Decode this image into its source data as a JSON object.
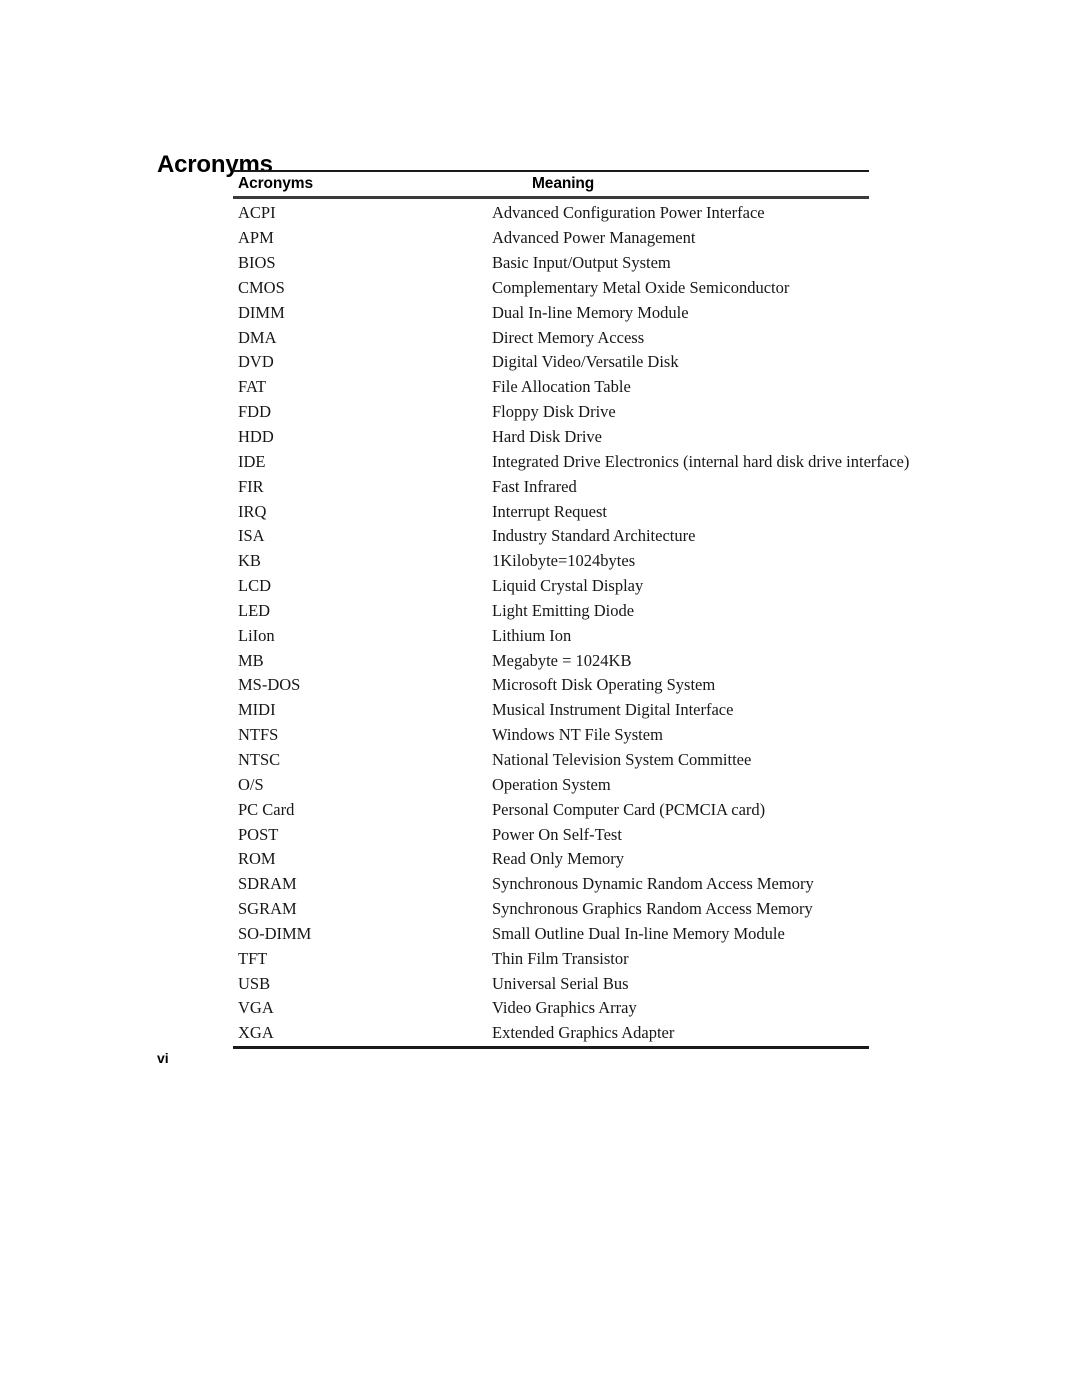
{
  "document": {
    "title": "Acronyms",
    "page_number": "vi"
  },
  "table": {
    "headers": {
      "acronym": "Acronyms",
      "meaning": "Meaning"
    },
    "rows": [
      {
        "acronym": "ACPI",
        "meaning": "Advanced Configuration Power Interface"
      },
      {
        "acronym": "APM",
        "meaning": "Advanced Power Management"
      },
      {
        "acronym": "BIOS",
        "meaning": "Basic Input/Output System"
      },
      {
        "acronym": "CMOS",
        "meaning": "Complementary Metal Oxide Semiconductor"
      },
      {
        "acronym": "DIMM",
        "meaning": "Dual In-line Memory Module"
      },
      {
        "acronym": "DMA",
        "meaning": "Direct Memory Access"
      },
      {
        "acronym": "DVD",
        "meaning": "Digital Video/Versatile Disk"
      },
      {
        "acronym": "FAT",
        "meaning": "File Allocation Table"
      },
      {
        "acronym": "FDD",
        "meaning": "Floppy Disk Drive"
      },
      {
        "acronym": "HDD",
        "meaning": "Hard Disk Drive"
      },
      {
        "acronym": "IDE",
        "meaning": "Integrated Drive Electronics (internal hard disk drive interface)"
      },
      {
        "acronym": "FIR",
        "meaning": "Fast Infrared"
      },
      {
        "acronym": "IRQ",
        "meaning": "Interrupt Request"
      },
      {
        "acronym": "ISA",
        "meaning": "Industry Standard Architecture"
      },
      {
        "acronym": "KB",
        "meaning": "1Kilobyte=1024bytes"
      },
      {
        "acronym": "LCD",
        "meaning": "Liquid Crystal Display"
      },
      {
        "acronym": "LED",
        "meaning": "Light Emitting Diode"
      },
      {
        "acronym": "LiIon",
        "meaning": "Lithium Ion"
      },
      {
        "acronym": "MB",
        "meaning": "Megabyte = 1024KB"
      },
      {
        "acronym": "MS-DOS",
        "meaning": "Microsoft Disk Operating System"
      },
      {
        "acronym": "MIDI",
        "meaning": "Musical Instrument Digital Interface"
      },
      {
        "acronym": "NTFS",
        "meaning": "Windows NT File System"
      },
      {
        "acronym": "NTSC",
        "meaning": "National Television System Committee"
      },
      {
        "acronym": "O/S",
        "meaning": "Operation System"
      },
      {
        "acronym": "PC Card",
        "meaning": "Personal Computer Card (PCMCIA card)"
      },
      {
        "acronym": "POST",
        "meaning": "Power On Self-Test"
      },
      {
        "acronym": "ROM",
        "meaning": "Read Only Memory"
      },
      {
        "acronym": "SDRAM",
        "meaning": "Synchronous Dynamic Random Access Memory"
      },
      {
        "acronym": "SGRAM",
        "meaning": "Synchronous Graphics Random Access Memory"
      },
      {
        "acronym": "SO-DIMM",
        "meaning": "Small Outline Dual In-line Memory Module"
      },
      {
        "acronym": "TFT",
        "meaning": "Thin Film Transistor"
      },
      {
        "acronym": "USB",
        "meaning": "Universal Serial Bus"
      },
      {
        "acronym": "VGA",
        "meaning": "Video Graphics Array"
      },
      {
        "acronym": "XGA",
        "meaning": "Extended Graphics Adapter"
      }
    ]
  }
}
